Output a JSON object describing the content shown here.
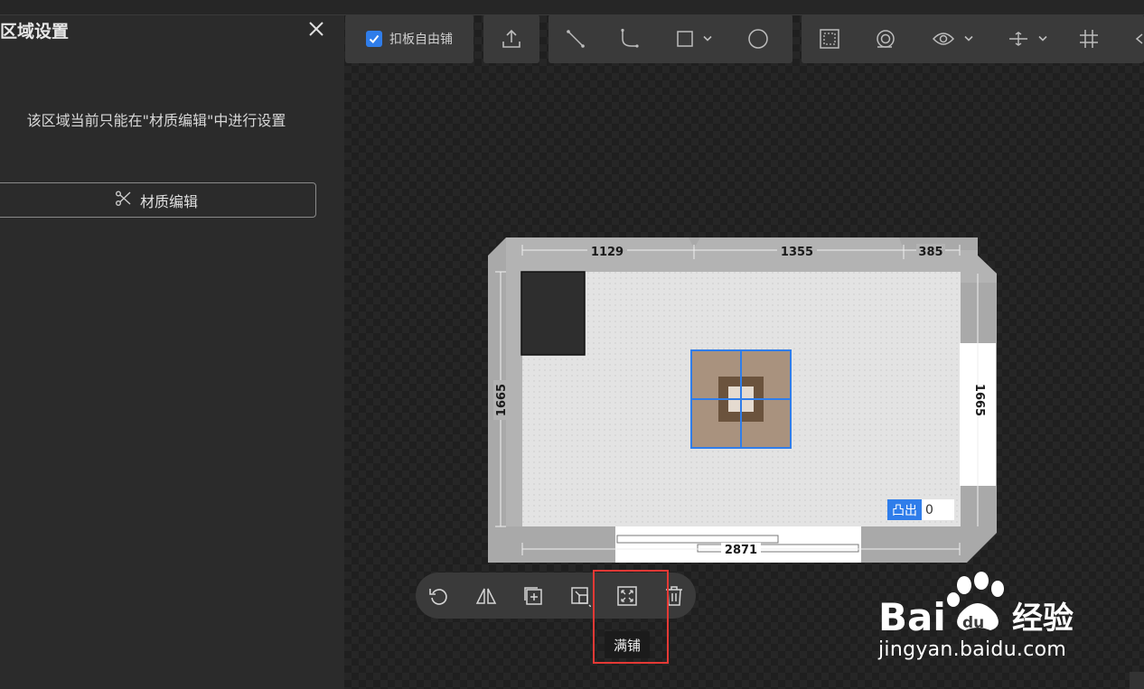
{
  "panel": {
    "title": "区域设置",
    "message": "该区域当前只能在\"材质编辑\"中进行设置",
    "material_button": "材质编辑"
  },
  "toolbar": {
    "free_tile_label": "扣板自由铺",
    "free_tile_checked": true
  },
  "room": {
    "top_dims": [
      "1129",
      "1355",
      "385"
    ],
    "left_dim": "1665",
    "right_dim": "1665",
    "bottom_dim": "2871",
    "convex_label": "凸出",
    "convex_value": "0"
  },
  "object_toolbar": {
    "tooltip": "满铺"
  },
  "watermark": {
    "brand": "Bai",
    "brand_du": "du",
    "brand_suffix": "经验",
    "url": "jingyan.baidu.com"
  },
  "colors": {
    "accent": "#2f7dea",
    "highlight": "#e53935"
  }
}
